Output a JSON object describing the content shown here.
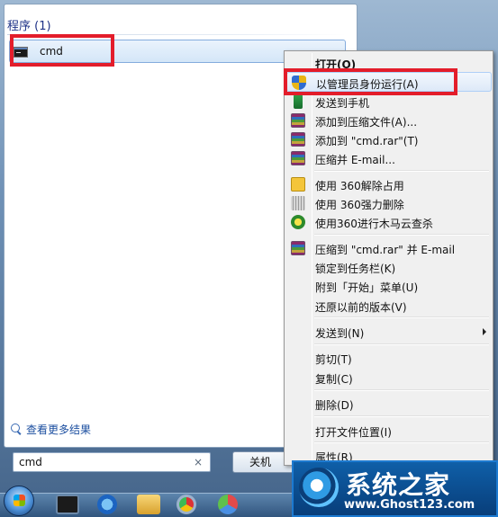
{
  "start_menu": {
    "group_header": "程序 (1)",
    "program": {
      "label": "cmd",
      "icon": "cmd-icon"
    },
    "see_more": "查看更多结果",
    "search": {
      "value": "cmd",
      "clear_glyph": "×"
    },
    "shutdown_label": "关机"
  },
  "context_menu": {
    "items": [
      {
        "label": "打开(O)",
        "bold": true
      },
      {
        "label": "以管理员身份运行(A)",
        "icon": "shield-icon",
        "highlighted": true
      },
      {
        "label": "发送到手机",
        "icon": "phone-icon"
      },
      {
        "label": "添加到压缩文件(A)...",
        "icon": "rar-icon"
      },
      {
        "label": "添加到 \"cmd.rar\"(T)",
        "icon": "rar-icon"
      },
      {
        "label": "压缩并 E-mail...",
        "icon": "rar-icon"
      },
      {
        "label": "使用 360解除占用",
        "icon": "unlock-icon"
      },
      {
        "label": "使用 360强力删除",
        "icon": "shred-icon"
      },
      {
        "label": "使用360进行木马云查杀",
        "icon": "trojan-icon"
      },
      {
        "label": "压缩到 \"cmd.rar\" 并 E-mail",
        "icon": "rar-icon"
      },
      {
        "label": "锁定到任务栏(K)"
      },
      {
        "label": "附到「开始」菜单(U)"
      },
      {
        "label": "还原以前的版本(V)"
      },
      {
        "label": "发送到(N)",
        "has_submenu": true
      },
      {
        "label": "剪切(T)"
      },
      {
        "label": "复制(C)"
      },
      {
        "label": "删除(D)"
      },
      {
        "label": "打开文件位置(I)"
      },
      {
        "label": "属性(R)"
      }
    ]
  },
  "taskbar": {
    "icons": [
      "start-orb-icon",
      "cmd-taskbar-icon",
      "ie-icon",
      "explorer-icon",
      "chrome-icon",
      "app-icon"
    ]
  },
  "watermark": {
    "title": "系统之家",
    "url": "www.Ghost123.com"
  },
  "colors": {
    "highlight_box": "#e31d2b",
    "menu_background": "#f0f0f0",
    "selection": "#d4e6f8"
  }
}
